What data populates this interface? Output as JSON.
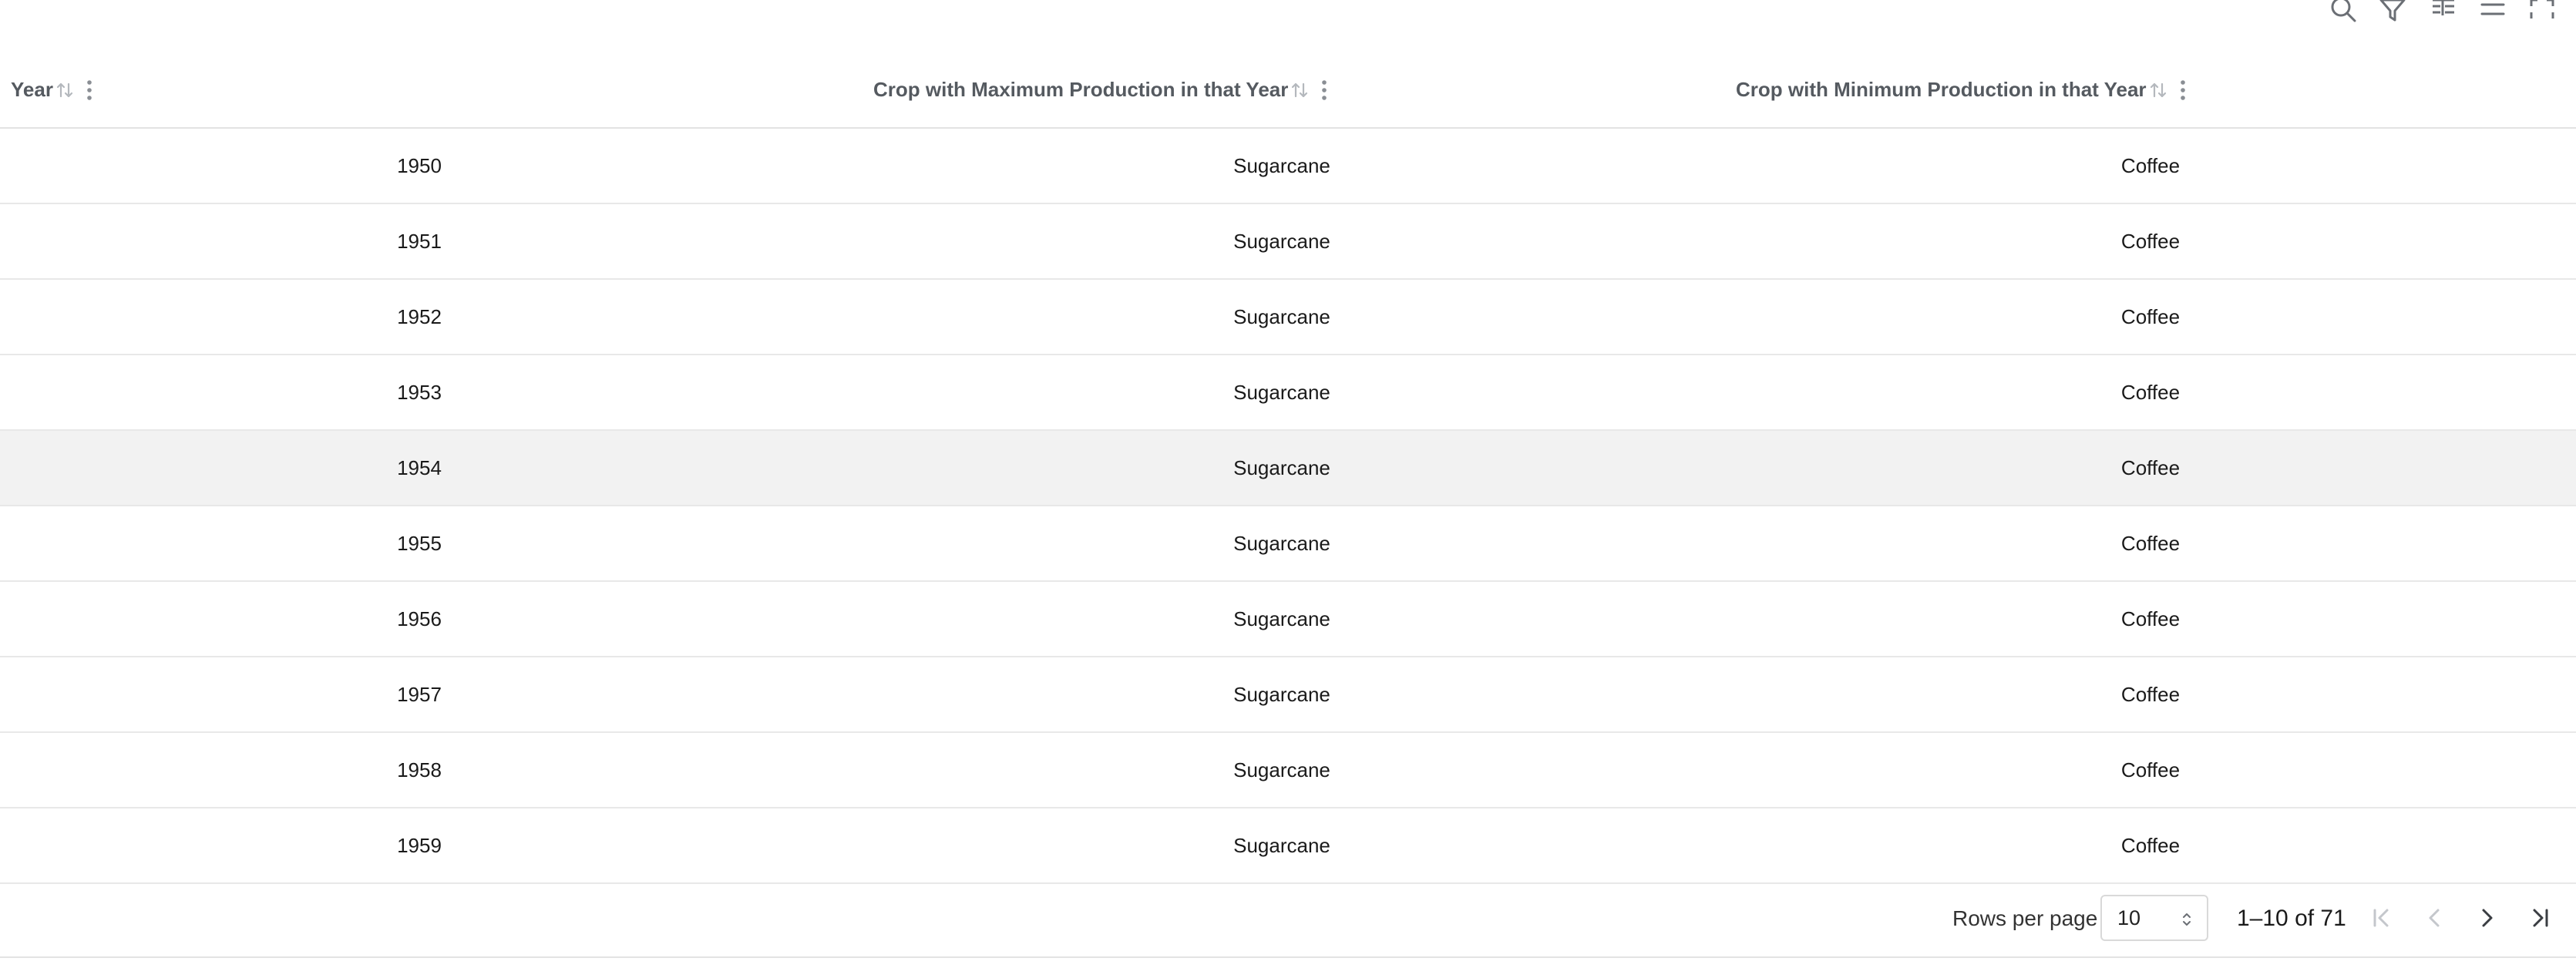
{
  "toolbar": {
    "icons": [
      "search-icon",
      "filter-icon",
      "columns-icon",
      "density-icon",
      "fullscreen-icon"
    ]
  },
  "table": {
    "columns": [
      {
        "label": "Year"
      },
      {
        "label": "Crop with Maximum Production in that Year"
      },
      {
        "label": "Crop with Minimum Production in that Year"
      }
    ],
    "rows": [
      {
        "year": "1950",
        "max_crop": "Sugarcane",
        "min_crop": "Coffee"
      },
      {
        "year": "1951",
        "max_crop": "Sugarcane",
        "min_crop": "Coffee"
      },
      {
        "year": "1952",
        "max_crop": "Sugarcane",
        "min_crop": "Coffee"
      },
      {
        "year": "1953",
        "max_crop": "Sugarcane",
        "min_crop": "Coffee"
      },
      {
        "year": "1954",
        "max_crop": "Sugarcane",
        "min_crop": "Coffee"
      },
      {
        "year": "1955",
        "max_crop": "Sugarcane",
        "min_crop": "Coffee"
      },
      {
        "year": "1956",
        "max_crop": "Sugarcane",
        "min_crop": "Coffee"
      },
      {
        "year": "1957",
        "max_crop": "Sugarcane",
        "min_crop": "Coffee"
      },
      {
        "year": "1958",
        "max_crop": "Sugarcane",
        "min_crop": "Coffee"
      },
      {
        "year": "1959",
        "max_crop": "Sugarcane",
        "min_crop": "Coffee"
      }
    ],
    "hovered_row_index": 4
  },
  "pagination": {
    "rows_per_page_label": "Rows per page",
    "rows_per_page_value": "10",
    "range_text": "1–10 of 71"
  },
  "colors": {
    "icon": "#6b6f75",
    "icon_disabled": "#c4c7cc",
    "row_hover": "#f2f2f2",
    "border": "#e3e3e3"
  }
}
